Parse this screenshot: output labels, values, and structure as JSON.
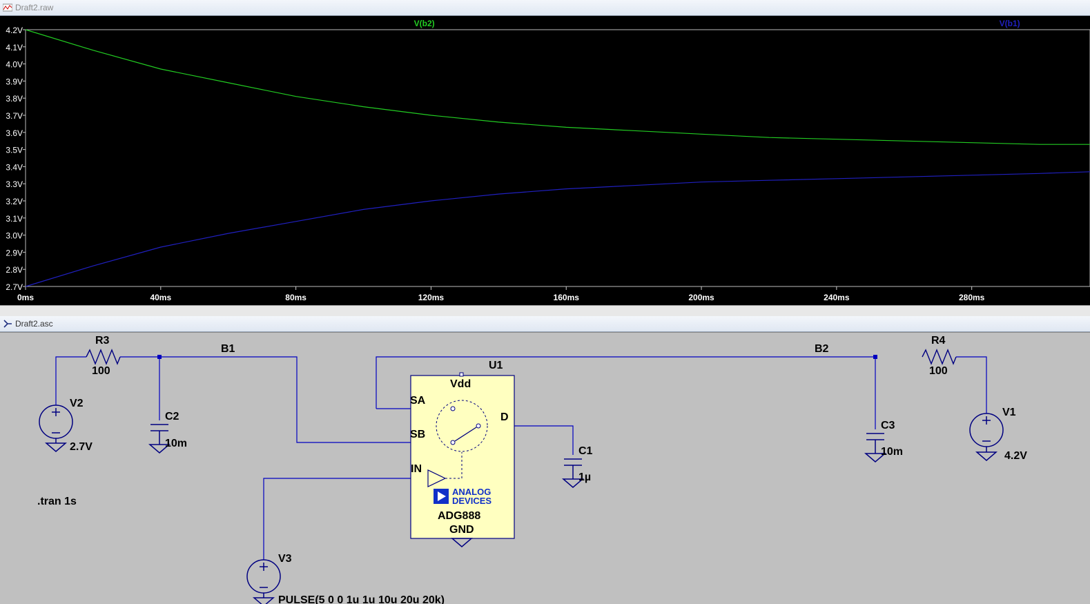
{
  "windows": {
    "waveform_title": "Draft2.raw",
    "schematic_title": "Draft2.asc"
  },
  "chart_data": {
    "type": "line",
    "title": "",
    "xlabel": "",
    "ylabel": "",
    "xlim": [
      0,
      315
    ],
    "ylim": [
      2.7,
      4.2
    ],
    "x_ticks": [
      "0ms",
      "40ms",
      "80ms",
      "120ms",
      "160ms",
      "200ms",
      "240ms",
      "280ms"
    ],
    "x_tick_values": [
      0,
      40,
      80,
      120,
      160,
      200,
      240,
      280
    ],
    "y_ticks": [
      "4.2V",
      "4.1V",
      "4.0V",
      "3.9V",
      "3.8V",
      "3.7V",
      "3.6V",
      "3.5V",
      "3.4V",
      "3.3V",
      "3.2V",
      "3.1V",
      "3.0V",
      "2.9V",
      "2.8V",
      "2.7V"
    ],
    "y_tick_values": [
      4.2,
      4.1,
      4.0,
      3.9,
      3.8,
      3.7,
      3.6,
      3.5,
      3.4,
      3.3,
      3.2,
      3.1,
      3.0,
      2.9,
      2.8,
      2.7
    ],
    "grid": false,
    "series": [
      {
        "name": "V(b2)",
        "color": "#22cc22",
        "x": [
          0,
          20,
          40,
          60,
          80,
          100,
          120,
          140,
          160,
          180,
          200,
          220,
          240,
          260,
          280,
          300,
          315
        ],
        "values": [
          4.2,
          4.08,
          3.97,
          3.89,
          3.81,
          3.75,
          3.7,
          3.66,
          3.63,
          3.61,
          3.59,
          3.57,
          3.56,
          3.55,
          3.54,
          3.53,
          3.53
        ]
      },
      {
        "name": "V(b1)",
        "color": "#2020c0",
        "x": [
          0,
          20,
          40,
          60,
          80,
          100,
          120,
          140,
          160,
          180,
          200,
          220,
          240,
          260,
          280,
          300,
          315
        ],
        "values": [
          2.7,
          2.82,
          2.93,
          3.01,
          3.08,
          3.15,
          3.2,
          3.24,
          3.27,
          3.29,
          3.31,
          3.32,
          3.33,
          3.34,
          3.35,
          3.36,
          3.37
        ]
      }
    ]
  },
  "schematic": {
    "labels": {
      "r3": "R3",
      "r3_val": "100",
      "r4": "R4",
      "r4_val": "100",
      "net_b1": "B1",
      "net_b2": "B2",
      "u1": "U1",
      "vdd": "Vdd",
      "sa": "SA",
      "sb": "SB",
      "d": "D",
      "in": "IN",
      "adi1": "ANALOG",
      "adi2": "DEVICES",
      "part": "ADG888",
      "gnd": "GND",
      "v2": "V2",
      "v2_val": "2.7V",
      "v1": "V1",
      "v1_val": "4.2V",
      "v3": "V3",
      "v3_val": "PULSE(5 0 0 1u 1u 10u 20u 20k)",
      "c2": "C2",
      "c2_val": "10m",
      "c3": "C3",
      "c3_val": "10m",
      "c1": "C1",
      "c1_val": "1µ",
      "directive": ".tran 1s"
    },
    "colors": {
      "wire": "#0000c0",
      "component": "#000080",
      "ic_fill": "#ffffc0",
      "adi_blue": "#1030c8"
    }
  }
}
